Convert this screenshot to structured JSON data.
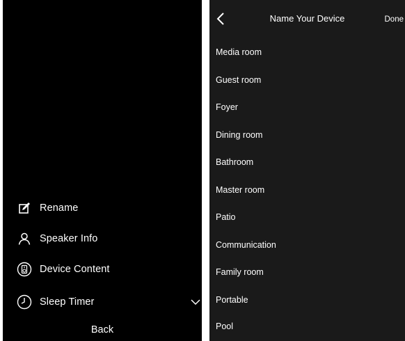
{
  "left_panel": {
    "menu": {
      "rename": "Rename",
      "speaker_info": "Speaker Info",
      "device_content": "Device Content",
      "sleep_timer": "Sleep Timer"
    },
    "back_label": "Back",
    "icons": [
      "edit-icon",
      "person-icon",
      "speaker-icon",
      "clock-icon",
      "chevron-down-icon"
    ]
  },
  "right_panel": {
    "header": {
      "title": "Name Your Device",
      "done_label": "Done"
    },
    "rooms": [
      "Media room",
      "Guest room",
      "Foyer",
      "Dining room",
      "Bathroom",
      "Master room",
      "Patio",
      "Communication",
      "Family room",
      "Portable",
      "Pool"
    ]
  },
  "colors": {
    "left_background": "#000000",
    "right_background": "#1a1a1a",
    "text": "#ffffff",
    "page_background": "#ffffff"
  }
}
